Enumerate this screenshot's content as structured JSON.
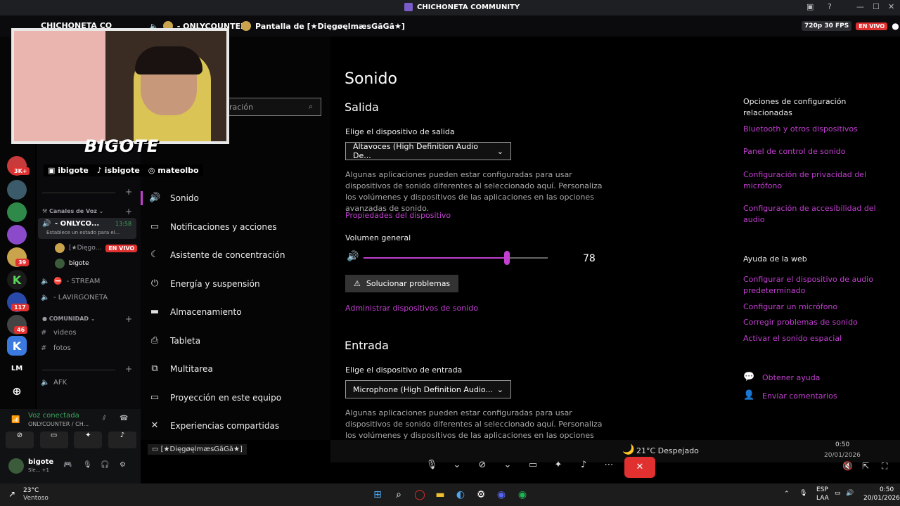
{
  "window": {
    "title": "CHICHONETA COMMUNITY"
  },
  "stream_tabs": {
    "tab1": "CHICHONETA CO",
    "tab2": "- ONLYCOUNTER",
    "tab3": "Pantalla de [★DięgøęlmæsGãGã★]",
    "quality": "720p 30 FPS",
    "live_badge": "EN VIVO"
  },
  "servers": {
    "badges": [
      "3K+",
      "39",
      "117",
      "46"
    ],
    "lm": "LM"
  },
  "channels": {
    "voice_category": "Canales de Voz",
    "onlycounter": "- ONLYCO...",
    "onlycounter_time": "13:58",
    "onlycounter_status": "Establece un estado para el...",
    "member1": "[★Dięgo...",
    "member1_badge": "EN VIVO",
    "member2": "bigote",
    "stream": "- STREAM",
    "lavirgoneta": "- LAVIRGONETA",
    "community_category": "COMUNIDAD",
    "videos": "videos",
    "fotos": "fotos",
    "afk": "AFK"
  },
  "voice_panel": {
    "status": "Voz conectada",
    "channel": "ONLYCOUNTER / CH...",
    "user": "bigote",
    "user_status": "Sle... +1"
  },
  "overlay": {
    "name": "BIGOTE",
    "social1": "ibigote",
    "social2": "isbigote",
    "social3": "mateolbo"
  },
  "settings_nav": {
    "search_placeholder": "ración",
    "items": [
      {
        "label": "Sonido",
        "icon": "speaker-icon"
      },
      {
        "label": "Notificaciones y acciones",
        "icon": "notification-icon"
      },
      {
        "label": "Asistente de concentración",
        "icon": "moon-icon"
      },
      {
        "label": "Energía y suspensión",
        "icon": "power-icon"
      },
      {
        "label": "Almacenamiento",
        "icon": "storage-icon"
      },
      {
        "label": "Tableta",
        "icon": "tablet-icon"
      },
      {
        "label": "Multitarea",
        "icon": "multitask-icon"
      },
      {
        "label": "Proyección en este equipo",
        "icon": "projection-icon"
      },
      {
        "label": "Experiencias compartidas",
        "icon": "shared-icon"
      }
    ]
  },
  "sound": {
    "title": "Sonido",
    "output_heading": "Salida",
    "output_label": "Elige el dispositivo de salida",
    "output_device": "Altavoces (High Definition Audio De...",
    "output_desc": "Algunas aplicaciones pueden estar configuradas para usar dispositivos de sonido diferentes al seleccionado aquí. Personaliza los volúmenes y dispositivos de las aplicaciones en las opciones avanzadas de sonido.",
    "device_properties": "Propiedades del dispositivo",
    "volume_label": "Volumen general",
    "volume_value": "78",
    "volume_fraction": 0.78,
    "troubleshoot": "Solucionar problemas",
    "manage_devices": "Administrar dispositivos de sonido",
    "input_heading": "Entrada",
    "input_label": "Elige el dispositivo de entrada",
    "input_device": "Microphone (High Definition Audio...",
    "input_desc": "Algunas aplicaciones pueden estar configuradas para usar dispositivos de sonido diferentes al seleccionado aquí. Personaliza los volúmenes y dispositivos de las aplicaciones en las opciones avanzadas de sonido."
  },
  "related": {
    "heading": "Opciones de configuración relacionadas",
    "links": [
      "Bluetooth y otros dispositivos",
      "Panel de control de sonido",
      "Configuración de privacidad del micrófono",
      "Configuración de accesibilidad del audio"
    ],
    "web_heading": "Ayuda de la web",
    "web_links": [
      "Configurar el dispositivo de audio predeterminado",
      "Configurar un micrófono",
      "Corregir problemas de sonido",
      "Activar el sonido espacial"
    ],
    "help": "Obtener ayuda",
    "feedback": "Enviar comentarios"
  },
  "stream_footer": {
    "streamer": "[★DięgøęlmæsGãGã★]",
    "weather": "21°C  Despejado",
    "time": "0:50",
    "date": "20/01/2026"
  },
  "taskbar": {
    "weather_temp": "23°C",
    "weather_desc": "Ventoso",
    "lang": "ESP",
    "lang2": "LAA",
    "time": "0:50",
    "date": "20/01/2026"
  },
  "colors": {
    "accent": "#c23fd0",
    "live": "#e03030",
    "discord_bg": "#0a0a0c"
  }
}
